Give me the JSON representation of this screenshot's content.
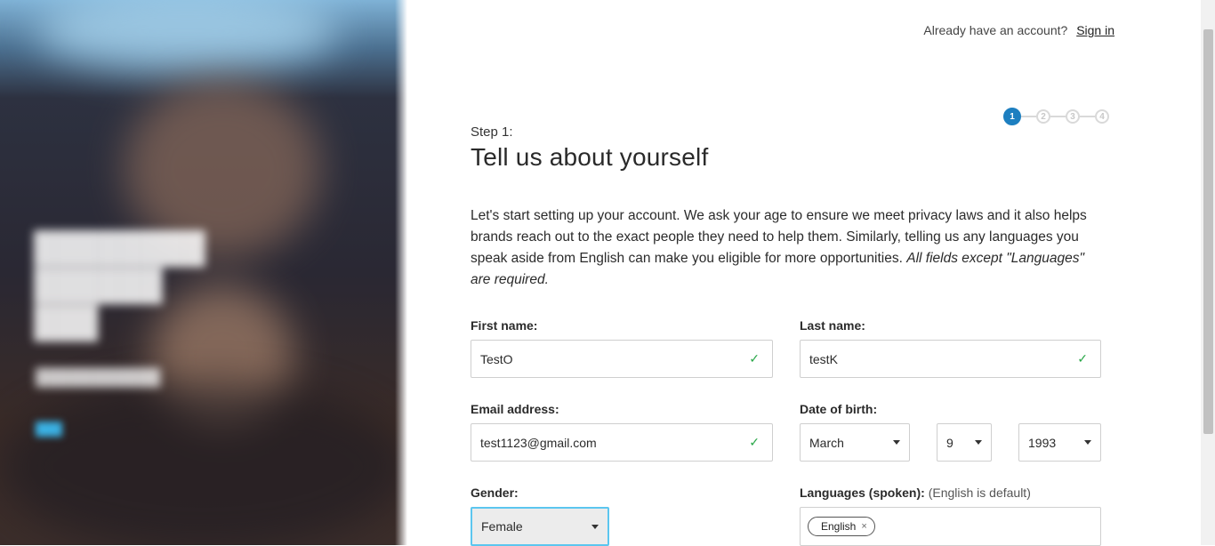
{
  "header": {
    "account_prompt": "Already have an account?",
    "signin_label": "Sign in"
  },
  "steps": [
    "1",
    "2",
    "3",
    "4"
  ],
  "current_step": "1",
  "form": {
    "step_label": "Step 1:",
    "title": "Tell us about yourself",
    "intro": "Let's start setting up your account. We ask your age to ensure we meet privacy laws and it also helps brands reach out to the exact people they need to help them. Similarly, telling us any languages you speak aside from English can make you eligible for more opportunities. ",
    "intro_emphasis": "All fields except \"Languages\" are required.",
    "first_name": {
      "label": "First name:",
      "value": "TestO"
    },
    "last_name": {
      "label": "Last name:",
      "value": "testK"
    },
    "email": {
      "label": "Email address:",
      "value": "test1123@gmail.com"
    },
    "dob": {
      "label": "Date of birth:",
      "month": "March",
      "day": "9",
      "year": "1993"
    },
    "gender": {
      "label": "Gender:",
      "value": "Female"
    },
    "languages": {
      "label": "Languages (spoken):",
      "note": "(English is default)",
      "chip": "English",
      "chip_remove": "×"
    }
  },
  "icons": {
    "valid": "check-icon",
    "dropdown": "chevron-down-icon",
    "remove": "close-icon"
  },
  "colors": {
    "accent": "#1d7fc0",
    "valid": "#2ba84a",
    "focus": "#5cc6ef"
  }
}
